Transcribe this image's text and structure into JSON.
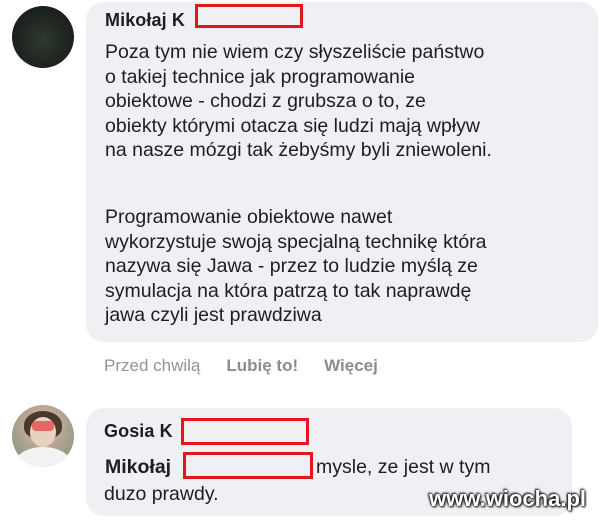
{
  "comment_1": {
    "author": "Mikołaj K",
    "paragraph_1": "Poza tym nie wiem czy słyszeliście państwo\no takiej technice jak programowanie\nobiektowe - chodzi z grubsza o to, ze\nobiekty którymi otacza się ludzi mają wpływ\nna nasze mózgi tak żebyśmy byli zniewoleni.",
    "paragraph_2": "Programowanie obiektowe nawet\nwykorzystuje swoją specjalną technikę która\nnazywa się Jawa - przez to ludzie myślą ze\nsymulacja na która patrzą to tak naprawdę\njawa czyli jest prawdziwa",
    "timestamp": "Przed chwilą",
    "like_label": "Lubię to!",
    "more_label": "Więcej"
  },
  "comment_2": {
    "author": "Gosia K",
    "mention": "Mikołaj",
    "text_tail": "mysle, ze jest w tym",
    "text_line2": "duzo prawdy."
  },
  "watermark": "www.wiocha.pl",
  "colors": {
    "bubble": "#eef0f3",
    "redaction": "#e3161d",
    "meta_text": "#8a8d91"
  },
  "icons": {
    "avatar_1": "avatar-dark-photo",
    "avatar_2": "avatar-woman-photo"
  }
}
